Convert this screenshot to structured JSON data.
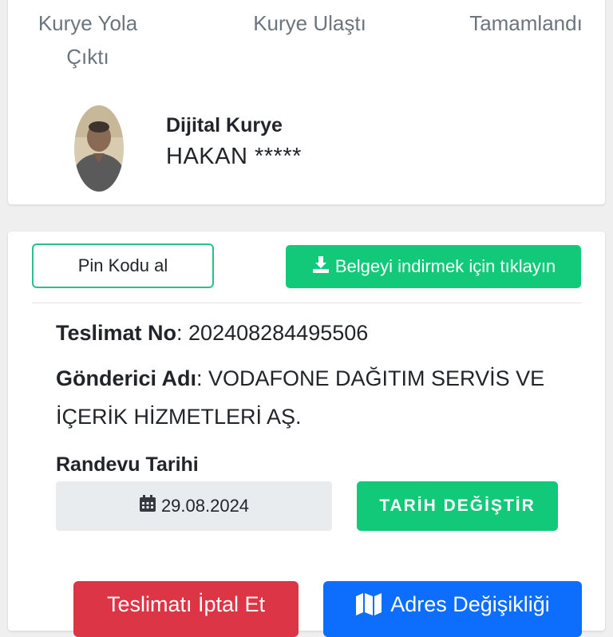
{
  "status_steps": [
    {
      "label": "Kurye Yola\nÇıktı"
    },
    {
      "label": "Kurye Ulaştı"
    },
    {
      "label": "Tamamlandı"
    }
  ],
  "courier": {
    "title": "Dijital Kurye",
    "name": "HAKAN *****"
  },
  "actions": {
    "pin_label": "Pin Kodu al",
    "download_label": "Belgeyi indirmek için tıklayın"
  },
  "delivery": {
    "number_label": "Teslimat No",
    "number_value": ": 202408284495506",
    "sender_label": "Gönderici Adı",
    "sender_value": ": VODAFONE DAĞITIM SERVİS VE İÇERİK HİZMETLERİ AŞ."
  },
  "appointment": {
    "label": "Randevu Tarihi",
    "date": "29.08.2024",
    "change_label": "TARİH DEĞİŞTİR"
  },
  "footer_buttons": {
    "cancel_label": "Teslimatı İptal Et",
    "address_label": "Adres Değişikliği"
  },
  "colors": {
    "green": "#12c979",
    "red": "#dc3545",
    "blue": "#0d6efd"
  }
}
